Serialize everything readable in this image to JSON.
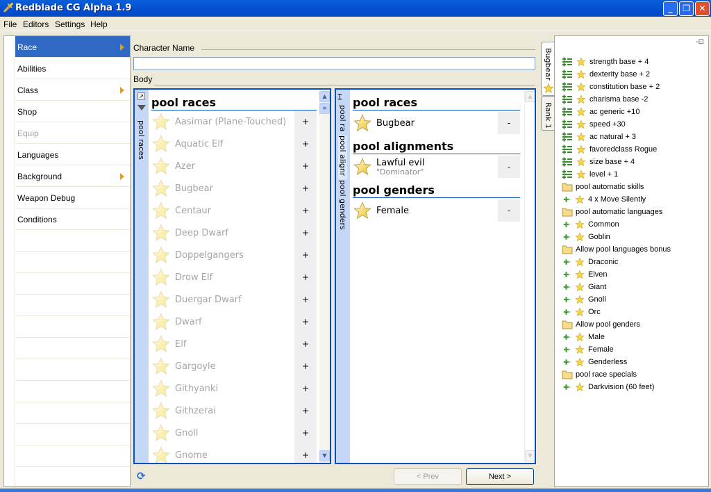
{
  "window": {
    "title": "Redblade CG Alpha 1.9",
    "controls": [
      "minimize",
      "maximize",
      "close"
    ]
  },
  "menu": [
    "File",
    "Editors",
    "Settings",
    "Help"
  ],
  "nav": [
    {
      "label": "Race",
      "selected": true,
      "submenu": true
    },
    {
      "label": "Abilities"
    },
    {
      "label": "Class",
      "submenu": true
    },
    {
      "label": "Shop"
    },
    {
      "label": "Equip",
      "disabled": true
    },
    {
      "label": "Languages"
    },
    {
      "label": "Background",
      "submenu": true
    },
    {
      "label": "Weapon Debug"
    },
    {
      "label": "Conditions"
    }
  ],
  "form": {
    "name_label": "Character Name",
    "name_value": "",
    "body_label": "Body"
  },
  "left_panel": {
    "strip_label": "pool races",
    "header": "pool races",
    "items": [
      "Aasimar (Plane-Touched)",
      "Aquatic Elf",
      "Azer",
      "Bugbear",
      "Centaur",
      "Deep Dwarf",
      "Doppelgangers",
      "Drow Elf",
      "Duergar Dwarf",
      "Dwarf",
      "Elf",
      "Gargoyle",
      "Githyanki",
      "Githzerai",
      "Gnoll",
      "Gnome"
    ],
    "add_label": "+"
  },
  "right_panel": {
    "strip_labels": [
      "pool ra",
      "pool alignr",
      "pool genders"
    ],
    "remove_label": "-",
    "sections": [
      {
        "header": "pool races",
        "items": [
          {
            "name": "Bugbear"
          }
        ]
      },
      {
        "header": "pool alignments",
        "items": [
          {
            "name": "Lawful evil",
            "sub": "\"Dominator\""
          }
        ]
      },
      {
        "header": "pool genders",
        "items": [
          {
            "name": "Female"
          }
        ]
      }
    ]
  },
  "buttons": {
    "prev": "< Prev",
    "next": "Next >"
  },
  "dock": {
    "tabs": [
      "Bugbear",
      "Rank 1"
    ],
    "tree": [
      {
        "type": "mod",
        "text": "strength base + 4"
      },
      {
        "type": "mod",
        "text": "dexterity base + 2"
      },
      {
        "type": "mod",
        "text": "constitution base + 2"
      },
      {
        "type": "mod",
        "text": "charisma base -2"
      },
      {
        "type": "mod",
        "text": "ac generic +10"
      },
      {
        "type": "mod",
        "text": "speed +30"
      },
      {
        "type": "mod",
        "text": "ac natural + 3"
      },
      {
        "type": "mod",
        "text": "favoredclass Rogue"
      },
      {
        "type": "mod",
        "text": "size base + 4"
      },
      {
        "type": "mod",
        "text": "level + 1"
      },
      {
        "type": "folder",
        "text": "pool automatic skills"
      },
      {
        "type": "child",
        "text": "4 x Move Silently"
      },
      {
        "type": "folder",
        "text": "pool automatic languages"
      },
      {
        "type": "child",
        "text": "Common"
      },
      {
        "type": "child",
        "text": "Goblin"
      },
      {
        "type": "folder",
        "text": "Allow pool languages bonus"
      },
      {
        "type": "child",
        "text": "Draconic"
      },
      {
        "type": "child",
        "text": "Elven"
      },
      {
        "type": "child",
        "text": "Giant"
      },
      {
        "type": "child",
        "text": "Gnoll"
      },
      {
        "type": "child",
        "text": "Orc"
      },
      {
        "type": "folder",
        "text": "Allow pool genders"
      },
      {
        "type": "child",
        "text": "Male"
      },
      {
        "type": "child",
        "text": "Female"
      },
      {
        "type": "child",
        "text": "Genderless"
      },
      {
        "type": "folder",
        "text": "pool race specials"
      },
      {
        "type": "child",
        "text": "Darkvision (60 feet)"
      }
    ]
  }
}
